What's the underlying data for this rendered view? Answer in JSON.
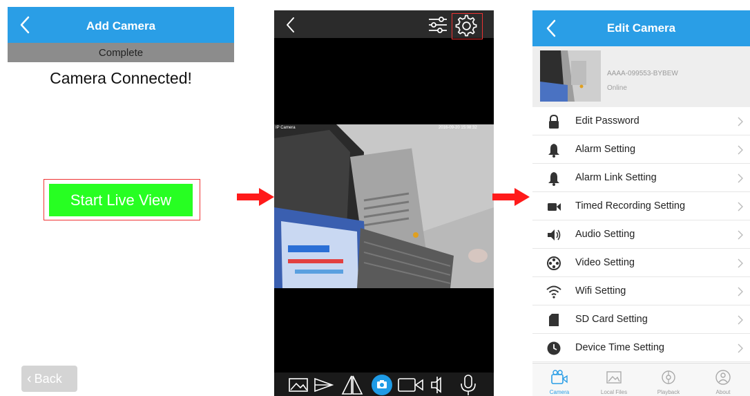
{
  "add_camera": {
    "title": "Add Camera",
    "step": "Complete",
    "message": "Camera Connected!",
    "start_live_view": "Start Live View",
    "back": "Back"
  },
  "live_view": {
    "overlay_left": "IP Camera",
    "overlay_right": "2016-09-20 15:08:32"
  },
  "edit_camera": {
    "title": "Edit Camera",
    "camera_id": "AAAA-099553-BYBEW",
    "status": "Online",
    "settings": [
      {
        "label": "Edit Password",
        "icon": "lock-icon"
      },
      {
        "label": "Alarm Setting",
        "icon": "bell-icon"
      },
      {
        "label": "Alarm Link Setting",
        "icon": "bell-icon"
      },
      {
        "label": "Timed Recording Setting",
        "icon": "video-camera-icon"
      },
      {
        "label": "Audio Setting",
        "icon": "speaker-icon"
      },
      {
        "label": "Video Setting",
        "icon": "film-reel-icon"
      },
      {
        "label": "Wifi Setting",
        "icon": "wifi-icon"
      },
      {
        "label": "SD Card Setting",
        "icon": "sd-card-icon"
      },
      {
        "label": "Device Time Setting",
        "icon": "clock-icon"
      }
    ],
    "tabs": [
      {
        "label": "Camera",
        "icon": "camera-tab-icon",
        "active": true
      },
      {
        "label": "Local Files",
        "icon": "image-tab-icon",
        "active": false
      },
      {
        "label": "Playback",
        "icon": "playback-tab-icon",
        "active": false
      },
      {
        "label": "About",
        "icon": "about-tab-icon",
        "active": false
      }
    ]
  },
  "colors": {
    "header_blue": "#2a9ee6",
    "live_green": "#27ff22",
    "highlight_red": "#e33333",
    "arrow_red": "#ff1a1a"
  }
}
